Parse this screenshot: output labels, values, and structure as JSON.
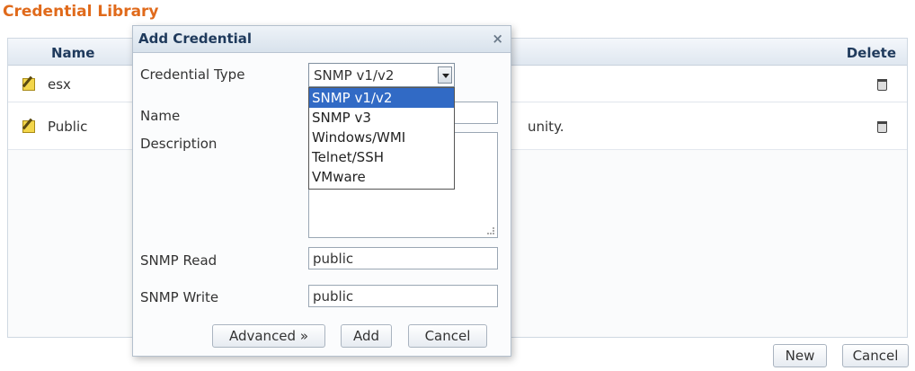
{
  "page": {
    "title": "Credential Library"
  },
  "grid": {
    "columns": {
      "name": "Name",
      "delete": "Delete"
    },
    "rows": [
      {
        "name": "esx",
        "description": ""
      },
      {
        "name": "Public",
        "description": "unity."
      }
    ]
  },
  "main_buttons": {
    "new": "New",
    "cancel": "Cancel"
  },
  "dialog": {
    "title": "Add Credential",
    "close": "×",
    "labels": {
      "credential_type": "Credential Type",
      "name": "Name",
      "description": "Description",
      "snmp_read": "SNMP Read",
      "snmp_write": "SNMP Write"
    },
    "credential_type_value": "SNMP v1/v2",
    "options": [
      "SNMP v1/v2",
      "SNMP v3",
      "Windows/WMI",
      "Telnet/SSH",
      "VMware"
    ],
    "selected_option": "SNMP v1/v2",
    "fields": {
      "name": "",
      "description": "",
      "snmp_read": "public",
      "snmp_write": "public"
    },
    "buttons": {
      "advanced": "Advanced »",
      "add": "Add",
      "cancel": "Cancel"
    }
  }
}
